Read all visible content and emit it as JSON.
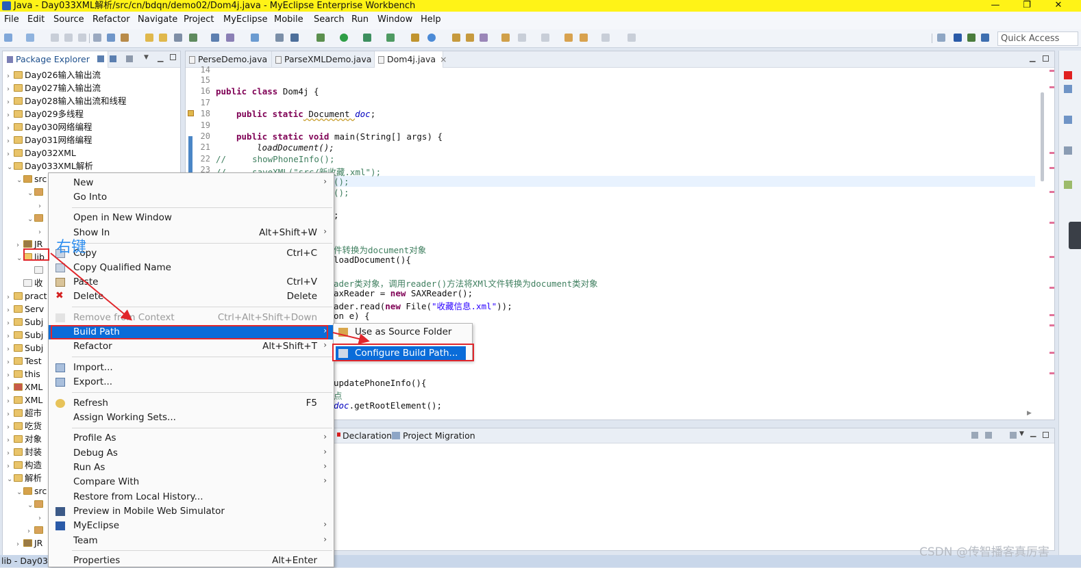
{
  "window": {
    "title": "Java - Day033XML解析/src/cn/bdqn/demo02/Dom4j.java - MyEclipse Enterprise Workbench",
    "minimize": "—",
    "maximize": "❐",
    "close": "✕"
  },
  "menubar": [
    "File",
    "Edit",
    "Source",
    "Refactor",
    "Navigate",
    "Project",
    "MyEclipse",
    "Mobile",
    "Search",
    "Run",
    "Window",
    "Help"
  ],
  "toolbar": {
    "quick_access": "Quick Access"
  },
  "package_explorer": {
    "title": "Package Explorer",
    "close": "×",
    "items": [
      "Day026输入输出流",
      "Day027输入输出流",
      "Day028输入输出流和线程",
      "Day029多线程",
      "Day030网络编程",
      "Day031网络编程",
      "Day032XML",
      "Day033XML解析",
      "src",
      "JR",
      "lib",
      "收",
      "pract",
      "Serv",
      "Subj",
      "Subj",
      "Subj",
      "Test",
      "this",
      "XML",
      "XML",
      "超市",
      "吃货",
      "对象",
      "封装",
      "构造",
      "解析",
      "src",
      "JR"
    ]
  },
  "editor": {
    "tabs": [
      "PerseDemo.java",
      "ParseXMLDemo.java",
      "Dom4j.java"
    ],
    "active_close": "×",
    "line_numbers": [
      "14",
      "15",
      "16",
      "17",
      "18",
      "19",
      "20",
      "21",
      "22",
      "23"
    ],
    "code": {
      "l16_kw": "public class",
      "l16_rest": " Dom4j {",
      "l18_kw": "public static",
      "l18_type": " Document ",
      "l18_field": "doc",
      "l18_end": ";",
      "l20_kw": "public static void",
      "l20_rest": " main(String[] args) {",
      "l21": "loadDocument();",
      "l22_cm": "//",
      "l22_rest": "showPhoneInfo();",
      "l23_cm": "//",
      "l23_pre": "saveXML(",
      "l23_str": "\"src/新收藏.xml\"",
      "l23_end": ");",
      "frag_a": "();",
      "frag_b": "();",
      "frag_c": ";",
      "frag_d": "件转换为document对象",
      "frag_e": "loadDocument(){",
      "frag_f": "ader类对象，调用reader()方法将XMl文件转换为document类对象",
      "frag_g1": "axReader = ",
      "frag_g2": "new",
      "frag_g3": " SAXReader();",
      "frag_h1": "ader.read(",
      "frag_h2": "new",
      "frag_h3": " File(",
      "frag_h4": "\"收藏信息.xml\"",
      "frag_h5": "));",
      "frag_i": "on e) {",
      "frag_j": "updatePhoneInfo(){",
      "frag_k": "点",
      "frag_l1": "doc",
      "frag_l2": ".getRootElement();"
    }
  },
  "bottom_panel": {
    "tabs": [
      "Declaration",
      "Project Migration"
    ]
  },
  "context_menu": {
    "items": [
      {
        "label": "New",
        "accel": "",
        "submenu": true
      },
      {
        "label": "Go Into",
        "accel": "",
        "submenu": false
      },
      {
        "label": "Open in New Window",
        "accel": "",
        "submenu": false
      },
      {
        "label": "Show In",
        "accel": "Alt+Shift+W",
        "submenu": true
      },
      {
        "label": "Copy",
        "accel": "Ctrl+C",
        "submenu": false
      },
      {
        "label": "Copy Qualified Name",
        "accel": "",
        "submenu": false
      },
      {
        "label": "Paste",
        "accel": "Ctrl+V",
        "submenu": false
      },
      {
        "label": "Delete",
        "accel": "Delete",
        "submenu": false
      },
      {
        "label": "Remove from Context",
        "accel": "Ctrl+Alt+Shift+Down",
        "submenu": false
      },
      {
        "label": "Build Path",
        "accel": "",
        "submenu": true
      },
      {
        "label": "Refactor",
        "accel": "Alt+Shift+T",
        "submenu": true
      },
      {
        "label": "Import...",
        "accel": "",
        "submenu": false
      },
      {
        "label": "Export...",
        "accel": "",
        "submenu": false
      },
      {
        "label": "Refresh",
        "accel": "F5",
        "submenu": false
      },
      {
        "label": "Assign Working Sets...",
        "accel": "",
        "submenu": false
      },
      {
        "label": "Profile As",
        "accel": "",
        "submenu": true
      },
      {
        "label": "Debug As",
        "accel": "",
        "submenu": true
      },
      {
        "label": "Run As",
        "accel": "",
        "submenu": true
      },
      {
        "label": "Compare With",
        "accel": "",
        "submenu": true
      },
      {
        "label": "Restore from Local History...",
        "accel": "",
        "submenu": false
      },
      {
        "label": "Preview in Mobile Web Simulator",
        "accel": "",
        "submenu": false
      },
      {
        "label": "MyEclipse",
        "accel": "",
        "submenu": true
      },
      {
        "label": "Team",
        "accel": "",
        "submenu": true
      },
      {
        "label": "Properties",
        "accel": "Alt+Enter",
        "submenu": false
      }
    ],
    "submenu_arrow": "›"
  },
  "build_path_submenu": {
    "items": [
      "Use as Source Folder",
      "Configure Build Path..."
    ]
  },
  "annotation": {
    "right_click": "右键"
  },
  "status_bar": {
    "text": "lib - Day033"
  },
  "watermark": "CSDN @传智播客真厉害",
  "colors": {
    "selection": "#0a6cd9",
    "highlight_box": "#e0262b",
    "title_bar": "#fff317",
    "annotation_text": "#2f8ff0"
  }
}
